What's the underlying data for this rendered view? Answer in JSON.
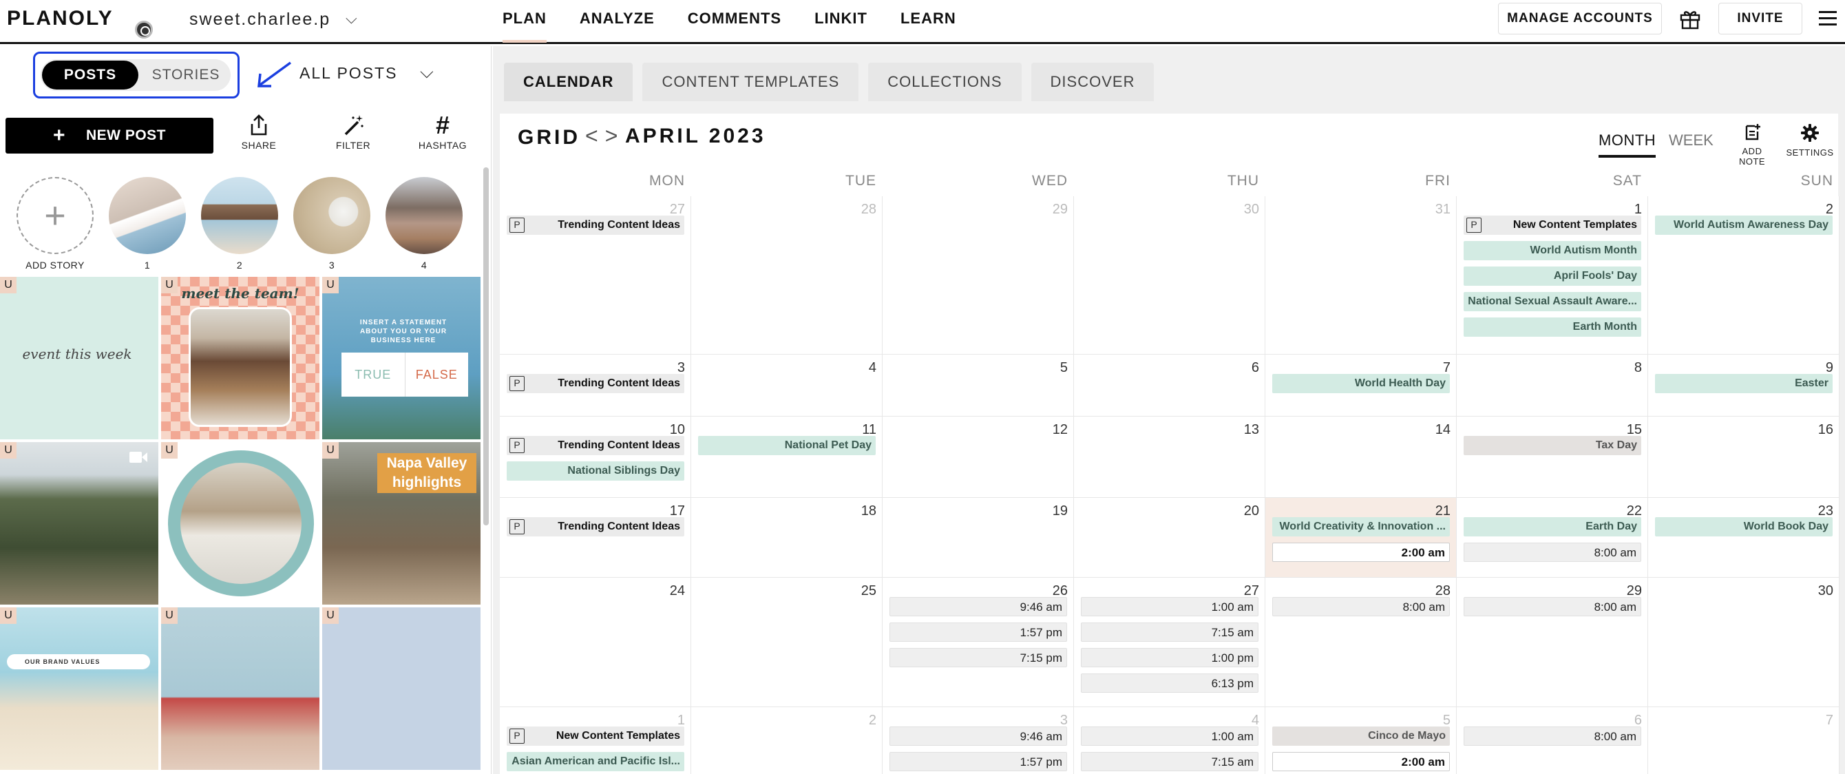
{
  "app": {
    "logo": "PLANOLY",
    "account": "sweet.charlee.p",
    "account_chevron": "⌵"
  },
  "nav": {
    "items": [
      "PLAN",
      "ANALYZE",
      "COMMENTS",
      "LINKIT",
      "LEARN"
    ],
    "manage_accounts": "MANAGE ACCOUNTS",
    "invite": "INVITE"
  },
  "left": {
    "toggle": {
      "posts": "POSTS",
      "stories": "STORIES"
    },
    "filter_label": "ALL POSTS",
    "filter_chevron": "⌵",
    "new_post": "NEW POST",
    "new_post_plus": "+",
    "tools": {
      "share": "SHARE",
      "filter": "FILTER",
      "hashtag": "HASHTAG",
      "hashtag_glyph": "#"
    },
    "stories": {
      "add_label": "ADD STORY",
      "add_glyph": "+",
      "items": [
        "1",
        "2",
        "3",
        "4"
      ]
    },
    "grid": {
      "badge": "U",
      "tile1_text": "event this week",
      "tile2_text": "meet the team!",
      "tile3_text": "INSERT A STATEMENT ABOUT YOU OR YOUR BUSINESS HERE",
      "tile3_true": "TRUE",
      "tile3_false": "FALSE",
      "tile6_text": "Napa Valley highlights",
      "tile7_text": "OUR BRAND VALUES"
    }
  },
  "right": {
    "tabs": [
      "CALENDAR",
      "CONTENT TEMPLATES",
      "COLLECTIONS",
      "DISCOVER"
    ],
    "grid_label": "GRID",
    "prev": "<",
    "next": ">",
    "month_title": "APRIL 2023",
    "view_month": "MONTH",
    "view_week": "WEEK",
    "add_note": "ADD NOTE",
    "settings": "SETTINGS",
    "planner_glyph": "P",
    "dow": [
      "MON",
      "TUE",
      "WED",
      "THU",
      "FRI",
      "SAT",
      "SUN"
    ]
  },
  "calendar": {
    "rows": [
      {
        "days": [
          {
            "n": "27",
            "muted": true,
            "ev": [
              {
                "t": "Trending Content Ideas",
                "k": "planner"
              }
            ]
          },
          {
            "n": "28",
            "muted": true,
            "ev": []
          },
          {
            "n": "29",
            "muted": true,
            "ev": []
          },
          {
            "n": "30",
            "muted": true,
            "ev": []
          },
          {
            "n": "31",
            "muted": true,
            "ev": []
          },
          {
            "n": "1",
            "ev": [
              {
                "t": "New Content Templates",
                "k": "planner"
              },
              {
                "t": "World Autism Month",
                "k": "teal"
              },
              {
                "t": "April Fools' Day",
                "k": "teal"
              },
              {
                "t": "National Sexual Assault Aware...",
                "k": "teal"
              },
              {
                "t": "Earth Month",
                "k": "teal"
              }
            ]
          },
          {
            "n": "2",
            "ev": [
              {
                "t": "World Autism Awareness Day",
                "k": "teal"
              }
            ]
          }
        ]
      },
      {
        "days": [
          {
            "n": "3",
            "ev": [
              {
                "t": "Trending Content Ideas",
                "k": "planner"
              }
            ]
          },
          {
            "n": "4",
            "ev": []
          },
          {
            "n": "5",
            "ev": []
          },
          {
            "n": "6",
            "ev": []
          },
          {
            "n": "7",
            "ev": [
              {
                "t": "World Health Day",
                "k": "teal"
              }
            ]
          },
          {
            "n": "8",
            "ev": []
          },
          {
            "n": "9",
            "ev": [
              {
                "t": "Easter",
                "k": "teal"
              }
            ]
          }
        ]
      },
      {
        "days": [
          {
            "n": "10",
            "ev": [
              {
                "t": "Trending Content Ideas",
                "k": "planner"
              },
              {
                "t": "National Siblings Day",
                "k": "teal"
              }
            ]
          },
          {
            "n": "11",
            "ev": [
              {
                "t": "National Pet Day",
                "k": "teal"
              }
            ]
          },
          {
            "n": "12",
            "ev": []
          },
          {
            "n": "13",
            "ev": []
          },
          {
            "n": "14",
            "ev": []
          },
          {
            "n": "15",
            "ev": [
              {
                "t": "Tax Day",
                "k": "grey"
              }
            ]
          },
          {
            "n": "16",
            "ev": []
          }
        ]
      },
      {
        "days": [
          {
            "n": "17",
            "ev": [
              {
                "t": "Trending Content Ideas",
                "k": "planner"
              }
            ]
          },
          {
            "n": "18",
            "ev": []
          },
          {
            "n": "19",
            "ev": []
          },
          {
            "n": "20",
            "ev": []
          },
          {
            "n": "21",
            "today": true,
            "ev": [
              {
                "t": "World Creativity & Innovation ...",
                "k": "teal"
              },
              {
                "t": "2:00 am",
                "k": "time-white"
              }
            ]
          },
          {
            "n": "22",
            "ev": [
              {
                "t": "Earth Day",
                "k": "teal"
              },
              {
                "t": "8:00 am",
                "k": "time"
              }
            ]
          },
          {
            "n": "23",
            "ev": [
              {
                "t": "World Book Day",
                "k": "teal"
              }
            ]
          }
        ]
      },
      {
        "days": [
          {
            "n": "24",
            "ev": []
          },
          {
            "n": "25",
            "ev": []
          },
          {
            "n": "26",
            "ev": [
              {
                "t": "9:46 am",
                "k": "time"
              },
              {
                "t": "1:57 pm",
                "k": "time"
              },
              {
                "t": "7:15 pm",
                "k": "time"
              }
            ]
          },
          {
            "n": "27",
            "ev": [
              {
                "t": "1:00 am",
                "k": "time"
              },
              {
                "t": "7:15 am",
                "k": "time"
              },
              {
                "t": "1:00 pm",
                "k": "time"
              },
              {
                "t": "6:13 pm",
                "k": "time"
              }
            ]
          },
          {
            "n": "28",
            "ev": [
              {
                "t": "8:00 am",
                "k": "time"
              }
            ]
          },
          {
            "n": "29",
            "ev": [
              {
                "t": "8:00 am",
                "k": "time"
              }
            ]
          },
          {
            "n": "30",
            "ev": []
          }
        ]
      },
      {
        "days": [
          {
            "n": "1",
            "muted": true,
            "ev": [
              {
                "t": "New Content Templates",
                "k": "planner"
              },
              {
                "t": "Asian American and Pacific Isl...",
                "k": "teal"
              }
            ]
          },
          {
            "n": "2",
            "muted": true,
            "ev": []
          },
          {
            "n": "3",
            "muted": true,
            "ev": [
              {
                "t": "9:46 am",
                "k": "time"
              },
              {
                "t": "1:57 pm",
                "k": "time"
              }
            ]
          },
          {
            "n": "4",
            "muted": true,
            "ev": [
              {
                "t": "1:00 am",
                "k": "time"
              },
              {
                "t": "7:15 am",
                "k": "time"
              }
            ]
          },
          {
            "n": "5",
            "muted": true,
            "ev": [
              {
                "t": "Cinco de Mayo",
                "k": "grey"
              },
              {
                "t": "2:00 am",
                "k": "time-white"
              }
            ]
          },
          {
            "n": "6",
            "muted": true,
            "ev": [
              {
                "t": "8:00 am",
                "k": "time"
              }
            ]
          },
          {
            "n": "7",
            "muted": true,
            "ev": []
          }
        ]
      }
    ]
  }
}
